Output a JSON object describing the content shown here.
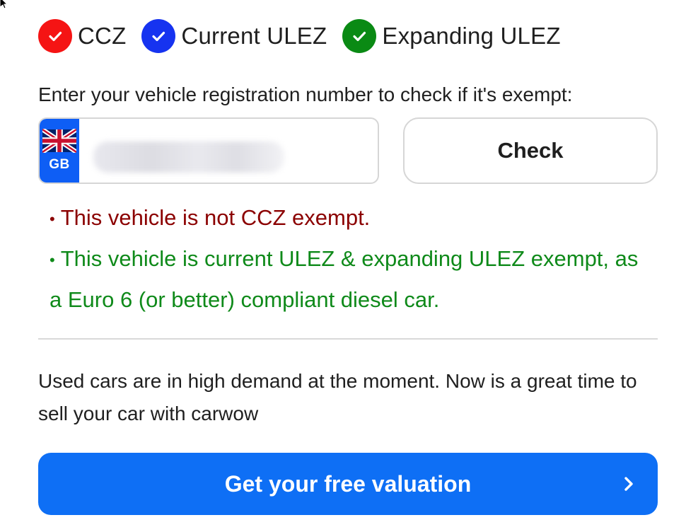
{
  "zones": [
    {
      "label": "CCZ",
      "color": "#f51414",
      "icon": "check-icon"
    },
    {
      "label": "Current ULEZ",
      "color": "#1633f0",
      "icon": "check-icon"
    },
    {
      "label": "Expanding ULEZ",
      "color": "#0a8a14",
      "icon": "check-icon"
    }
  ],
  "prompt": "Enter your vehicle registration number to check if it's exempt:",
  "registration": {
    "country_code": "GB",
    "value": "",
    "flag_icon": "uk-flag-icon",
    "strip_color": "#0e5ef5"
  },
  "check_button": "Check",
  "results": {
    "ccz": "This vehicle is not CCZ exempt.",
    "ulez": "This vehicle is current ULEZ & expanding ULEZ exempt, as a Euro 6 (or better) compliant diesel car.",
    "ccz_color": "#8b0000",
    "ulez_color": "#0f8a1a"
  },
  "promo_text": "Used cars are in high demand at the moment. Now is a great time to sell your car with carwow",
  "cta": {
    "label": "Get your free valuation",
    "icon": "chevron-right-icon",
    "color": "#0e6ff5"
  }
}
